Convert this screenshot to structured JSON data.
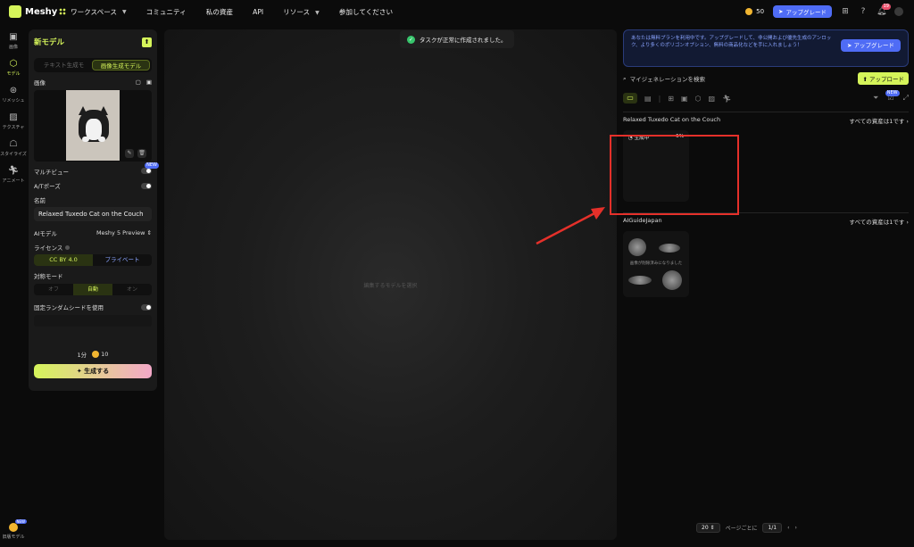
{
  "topbar": {
    "logo": "Meshy",
    "workspace": "ワークスペース",
    "nav": [
      "コミュニティ",
      "私の資産",
      "API",
      "リソース",
      "参加してください"
    ],
    "credits": "50",
    "upgrade": "アップグレード",
    "notif_count": "19"
  },
  "rail": {
    "items": [
      "画像",
      "モデル",
      "リメッシュ",
      "テクスチャ",
      "スタイライズ",
      "アニメート"
    ],
    "bottom_label": "旧版モデル",
    "bottom_badge": "NEW"
  },
  "left": {
    "title": "新モデル",
    "tabs": [
      "テキスト生成モ",
      "画像生成モデル"
    ],
    "image_label": "画像",
    "multiview": "マルチビュー",
    "multiview_badge": "NEW",
    "apose": "A/Tポーズ",
    "name_label": "名前",
    "name_value": "Relaxed Tuxedo Cat on the Couch",
    "ai_model_label": "AIモデル",
    "ai_model_value": "Meshy 5 Preview",
    "license_label": "ライセンス",
    "license_options": [
      "CC BY 4.0",
      "プライベート"
    ],
    "symmetry_label": "対称モード",
    "symmetry_options": [
      "オフ",
      "自動",
      "オン"
    ],
    "seed_label": "固定ランダムシードを使用",
    "time": "1分",
    "cost": "10",
    "generate": "生成する"
  },
  "canvas": {
    "hint": "編集するモデルを選択"
  },
  "toast": {
    "text": "タスクが正常に作成されました。"
  },
  "right": {
    "notice": "あなたは無料プランを利用中です。アップグレードして、非公開および優先生成のアンロック、より多くのポリゴンオプション、無料の商品化などを手に入れましょう！",
    "notice_button": "アップグレード",
    "search_placeholder": "マイジェネレーションを検索",
    "upload": "アップロード",
    "filter_badge": "NEW",
    "section1_title": "Relaxed Tuxedo Cat on the Couch",
    "section1_link": "すべての資産は1です",
    "card1_status": "生成中",
    "card1_progress": "5%",
    "section2_title": "AIGuideJapan",
    "section2_link": "すべての資産は1です",
    "card2_msg": "画像が削除済みになりました"
  },
  "pager": {
    "page_size": "20",
    "per_page": "ページごとに",
    "page": "1/1"
  }
}
